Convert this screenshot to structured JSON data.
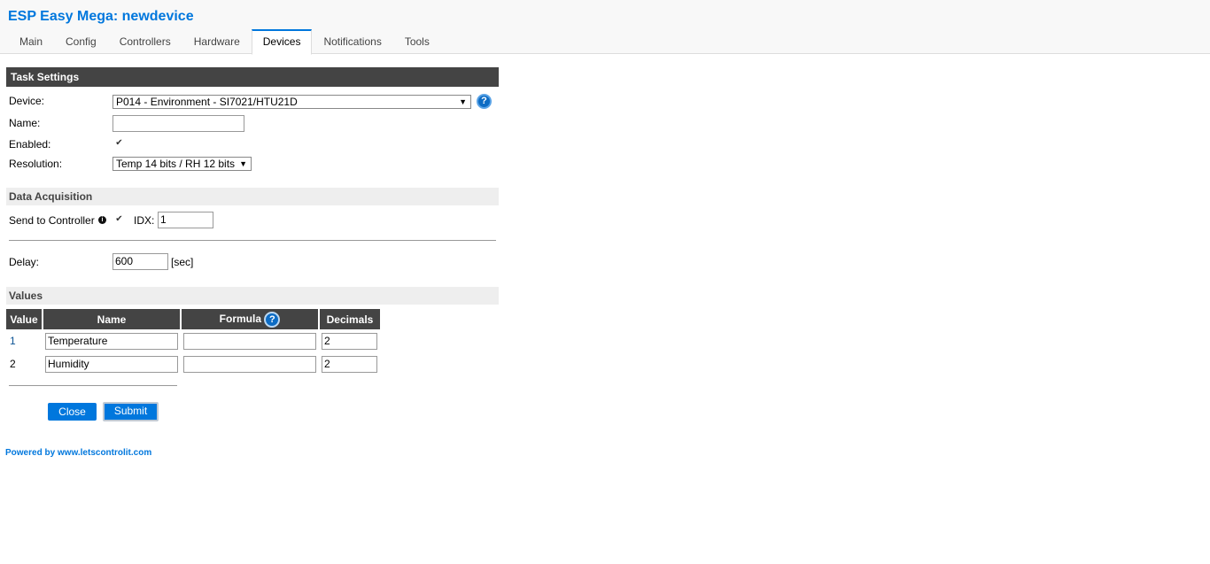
{
  "header": {
    "title": "ESP Easy Mega: newdevice",
    "tabs": [
      "Main",
      "Config",
      "Controllers",
      "Hardware",
      "Devices",
      "Notifications",
      "Tools"
    ],
    "active_tab": "Devices"
  },
  "task_settings": {
    "heading": "Task Settings",
    "device_label": "Device:",
    "device_value": "P014 - Environment - SI7021/HTU21D",
    "name_label": "Name:",
    "name_value": "",
    "enabled_label": "Enabled:",
    "enabled_checked": true,
    "resolution_label": "Resolution:",
    "resolution_value": "Temp 14 bits / RH 12 bits"
  },
  "data_acquisition": {
    "heading": "Data Acquisition",
    "send_label": "Send to Controller",
    "send_checked": true,
    "idx_label": "IDX:",
    "idx_value": "1",
    "delay_label": "Delay:",
    "delay_value": "600",
    "delay_unit": "[sec]"
  },
  "values": {
    "heading": "Values",
    "columns": [
      "Value",
      "Name",
      "Formula",
      "Decimals"
    ],
    "rows": [
      {
        "index": "1",
        "name": "Temperature",
        "formula": "",
        "decimals": "2"
      },
      {
        "index": "2",
        "name": "Humidity",
        "formula": "",
        "decimals": "2"
      }
    ]
  },
  "buttons": {
    "close": "Close",
    "submit": "Submit"
  },
  "footer": {
    "text": "Powered by www.letscontrolit.com"
  },
  "icons": {
    "help": "?",
    "info": "i",
    "check": "✔",
    "dropdown": "▼"
  },
  "colors": {
    "accent": "#0077dd",
    "dark_header": "#444444",
    "light_header": "#eeeeee"
  }
}
